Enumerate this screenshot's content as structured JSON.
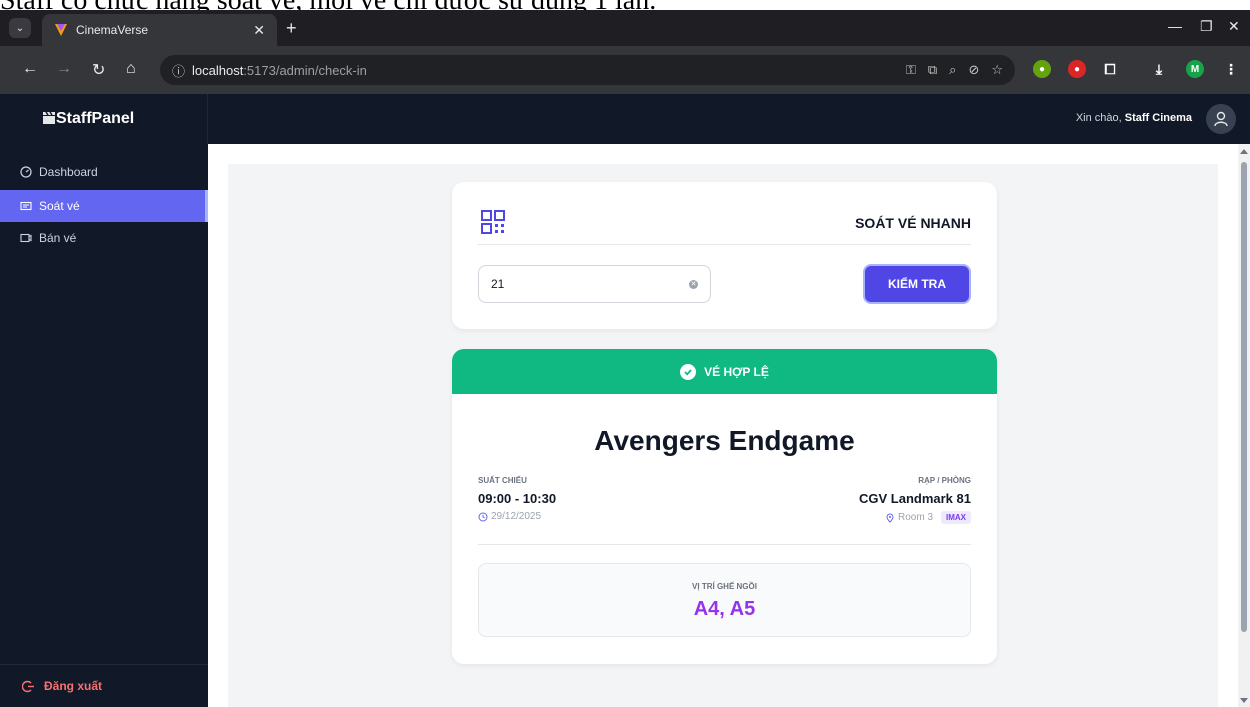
{
  "caption": "Staff có chức năng soát vé, mỗi vé chỉ được sử dụng 1 lần.",
  "browser": {
    "tab_title": "CinemaVerse",
    "url_host": "localhost",
    "url_path": ":5173/admin/check-in",
    "profile_initial": "M"
  },
  "header": {
    "brand": "StaffPanel",
    "greeting_prefix": "Xin chào,",
    "user_name": "Staff Cinema"
  },
  "sidebar": {
    "items": [
      {
        "label": "Dashboard",
        "icon": "dashboard-icon",
        "active": false
      },
      {
        "label": "Soát vé",
        "icon": "ticket-icon",
        "active": true
      },
      {
        "label": "Bán vé",
        "icon": "sell-ticket-icon",
        "active": false
      }
    ],
    "logout_label": "Đăng xuất"
  },
  "checkin": {
    "title": "SOÁT VÉ NHANH",
    "ticket_value": "21",
    "button_label": "KIỂM TRA"
  },
  "result": {
    "status": "VÉ HỢP LỆ",
    "status_color": "#10b981",
    "movie": "Avengers Endgame",
    "showtime_label": "SUẤT CHIẾU",
    "showtime": "09:00 - 10:30",
    "date": "29/12/2025",
    "cinema_label": "RẠP / PHÒNG",
    "cinema": "CGV Landmark 81",
    "room": "Room 3",
    "room_type": "IMAX",
    "seat_label": "VỊ TRÍ GHẾ NGỒI",
    "seats": "A4, A5"
  },
  "colors": {
    "accent": "#6366f1",
    "sidebar_bg": "#111827",
    "seat_color": "#9333ea"
  }
}
